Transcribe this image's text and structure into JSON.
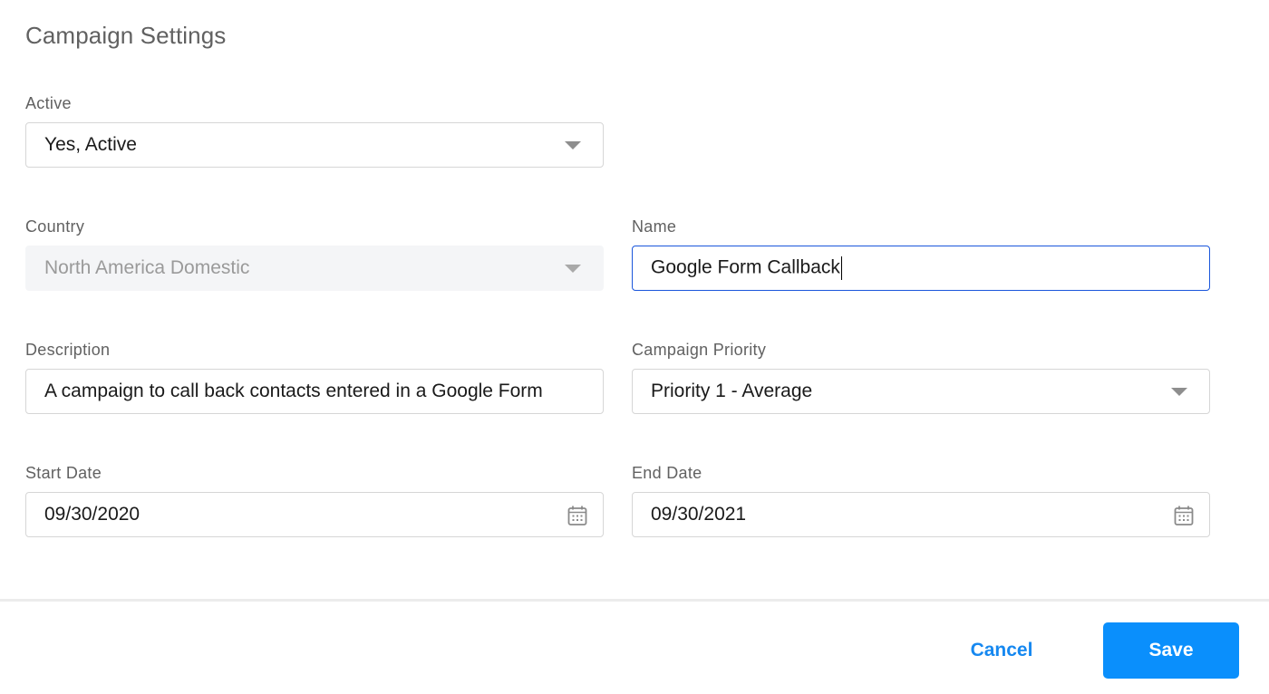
{
  "page": {
    "title": "Campaign Settings"
  },
  "fields": {
    "active": {
      "label": "Active",
      "value": "Yes, Active",
      "type": "select",
      "icon": "dropdown-arrow-icon"
    },
    "country": {
      "label": "Country",
      "value": "North America Domestic",
      "type": "select",
      "disabled": true,
      "icon": "dropdown-arrow-icon"
    },
    "name": {
      "label": "Name",
      "value": "Google Form Callback",
      "type": "text",
      "focused": true
    },
    "description": {
      "label": "Description",
      "value": "A campaign to call back contacts entered in a Google Form",
      "type": "text"
    },
    "priority": {
      "label": "Campaign Priority",
      "value": "Priority 1 - Average",
      "type": "select",
      "icon": "dropdown-arrow-icon"
    },
    "start_date": {
      "label": "Start Date",
      "value": "09/30/2020",
      "type": "date",
      "icon": "calendar-icon"
    },
    "end_date": {
      "label": "End Date",
      "value": "09/30/2021",
      "type": "date",
      "icon": "calendar-icon"
    }
  },
  "footer": {
    "cancel_label": "Cancel",
    "save_label": "Save"
  },
  "colors": {
    "accent": "#0a8ffc",
    "link": "#1688f0",
    "focus_border": "#1a56db",
    "disabled_bg": "#f4f5f7"
  }
}
